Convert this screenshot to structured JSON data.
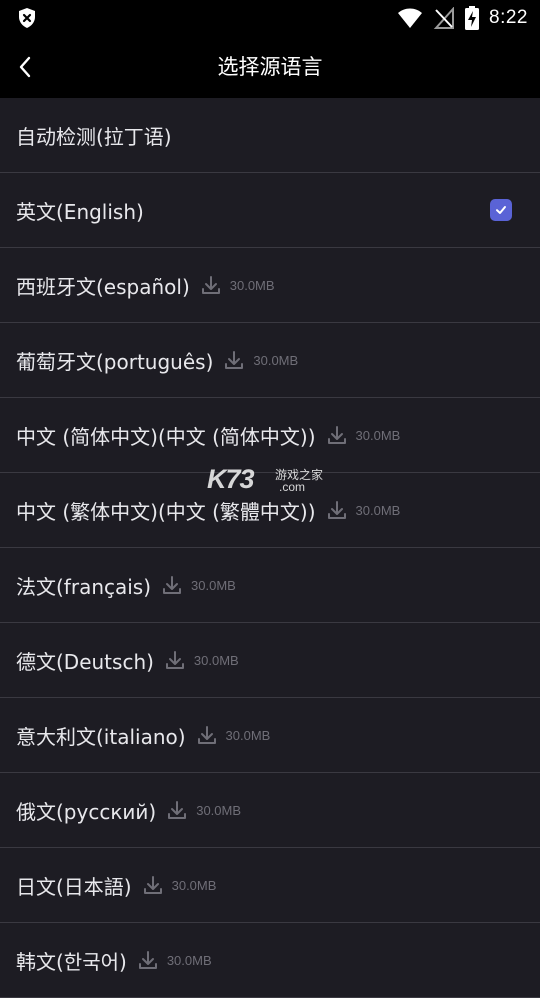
{
  "status_bar": {
    "time": "8:22",
    "icons": [
      "shield-x-icon",
      "wifi-icon",
      "no-sim-icon",
      "battery-charging-icon"
    ]
  },
  "app_bar": {
    "title": "选择源语言",
    "back_icon": "chevron-left-icon"
  },
  "languages": [
    {
      "label": "自动检测(拉丁语)",
      "size": "",
      "selected": false
    },
    {
      "label": "英文(English)",
      "size": "",
      "selected": true
    },
    {
      "label": "西班牙文(español)",
      "size": "30.0MB",
      "selected": false
    },
    {
      "label": "葡萄牙文(português)",
      "size": "30.0MB",
      "selected": false
    },
    {
      "label": "中文 (简体中文)(中文 (简体中文))",
      "size": "30.0MB",
      "selected": false
    },
    {
      "label": "中文 (繁体中文)(中文 (繁體中文))",
      "size": "30.0MB",
      "selected": false
    },
    {
      "label": "法文(français)",
      "size": "30.0MB",
      "selected": false
    },
    {
      "label": "德文(Deutsch)",
      "size": "30.0MB",
      "selected": false
    },
    {
      "label": "意大利文(italiano)",
      "size": "30.0MB",
      "selected": false
    },
    {
      "label": "俄文(русский)",
      "size": "30.0MB",
      "selected": false
    },
    {
      "label": "日文(日本語)",
      "size": "30.0MB",
      "selected": false
    },
    {
      "label": "韩文(한국어)",
      "size": "30.0MB",
      "selected": false
    }
  ],
  "watermark": {
    "brand": "K73",
    "chinese": "游戏之家",
    "domain": ".com"
  },
  "colors": {
    "background": "#1d1c23",
    "bar": "#000000",
    "divider": "#3a3941",
    "accent": "#5a63d6",
    "muted": "#6f6e77"
  }
}
